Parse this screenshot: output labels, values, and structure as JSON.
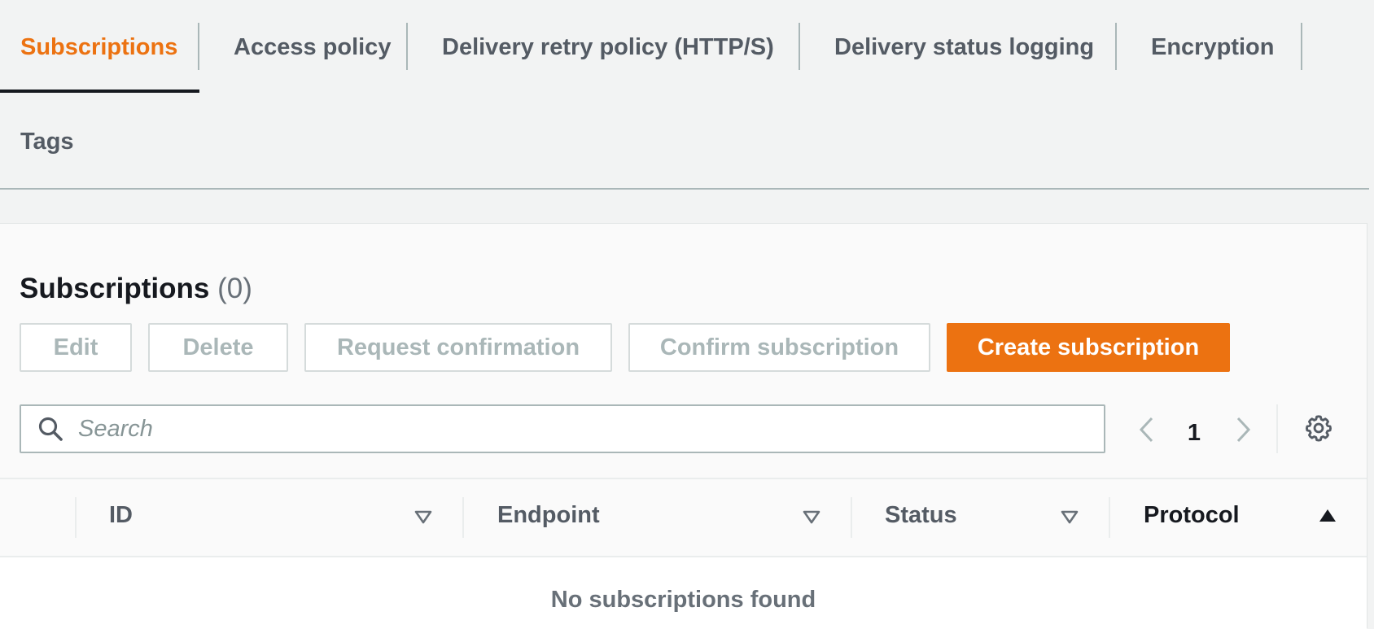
{
  "tabs": {
    "subscriptions": "Subscriptions",
    "access_policy": "Access policy",
    "delivery_retry": "Delivery retry policy (HTTP/S)",
    "delivery_status": "Delivery status logging",
    "encryption": "Encryption",
    "tags": "Tags"
  },
  "panel": {
    "title": "Subscriptions",
    "count": "(0)"
  },
  "actions": {
    "edit": "Edit",
    "delete": "Delete",
    "request_confirmation": "Request confirmation",
    "confirm_subscription": "Confirm subscription",
    "create_subscription": "Create subscription"
  },
  "search": {
    "placeholder": "Search",
    "value": ""
  },
  "pagination": {
    "current_page": "1"
  },
  "table": {
    "columns": [
      "ID",
      "Endpoint",
      "Status",
      "Protocol"
    ],
    "sorted_column": "Protocol",
    "empty_message": "No subscriptions found"
  },
  "colors": {
    "accent": "#ec7211",
    "active_tab_underline": "#16191f",
    "text": "#16191f",
    "muted_text": "#545b64",
    "disabled_text": "#aab7b8"
  },
  "icons": {
    "search": "search-icon",
    "prev": "chevron-left-icon",
    "next": "chevron-right-icon",
    "settings": "gear-icon",
    "sort_unsorted": "caret-down-outline-icon",
    "sort_ascending": "caret-up-filled-icon"
  }
}
